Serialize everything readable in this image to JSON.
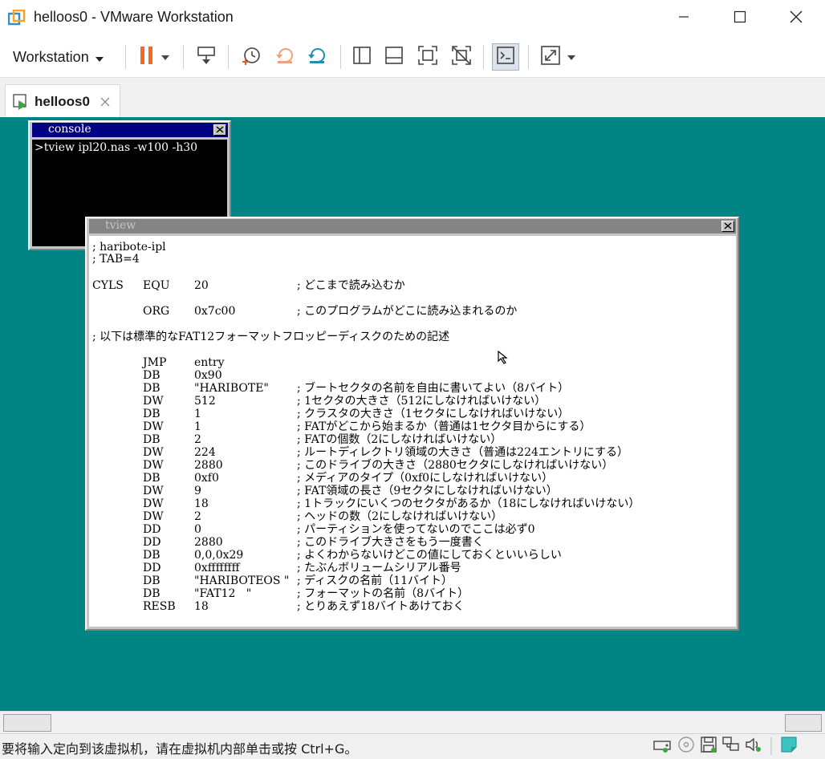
{
  "window": {
    "title": "helloos0 - VMware Workstation",
    "minimize_icon": "minimize-icon",
    "maximize_icon": "maximize-icon",
    "close_icon": "close-icon"
  },
  "toolbar": {
    "menu_label": "Workstation",
    "icons": [
      "pause-icon",
      "send-ctrl-alt-del-icon",
      "snapshot-take-icon",
      "snapshot-revert-icon",
      "snapshot-manager-icon",
      "view-sidebar-icon",
      "view-thumbnail-icon",
      "fullscreen-icon",
      "unity-disabled-icon",
      "console-view-icon",
      "stretch-icon"
    ]
  },
  "tabs": [
    {
      "label": "helloos0",
      "icon": "vm-running-icon",
      "close_icon": "tab-close-icon"
    }
  ],
  "guest": {
    "console": {
      "title": "console",
      "lines": [
        ">tview ipl20.nas -w100 -h30"
      ]
    },
    "tview": {
      "title": "tview",
      "header_lines": [
        "; haribote-ipl",
        "; TAB=4"
      ],
      "cyls": {
        "label": "CYLS",
        "op": "EQU",
        "arg": "20",
        "comment": "; どこまで読み込むか"
      },
      "org": {
        "op": "ORG",
        "arg": "0x7c00",
        "comment": "; このプログラムがどこに読み込まれるのか"
      },
      "section_comment": "; 以下は標準的なFAT12フォーマットフロッピーディスクのための記述",
      "rows": [
        {
          "op": "JMP",
          "arg": "entry",
          "comment": ""
        },
        {
          "op": "DB",
          "arg": "0x90",
          "comment": ""
        },
        {
          "op": "DB",
          "arg": "\"HARIBOTE\"",
          "comment": "; ブートセクタの名前を自由に書いてよい（8バイト）"
        },
        {
          "op": "DW",
          "arg": "512",
          "comment": "; 1セクタの大きさ（512にしなければいけない）"
        },
        {
          "op": "DB",
          "arg": "1",
          "comment": "; クラスタの大きさ（1セクタにしなければいけない）"
        },
        {
          "op": "DW",
          "arg": "1",
          "comment": "; FATがどこから始まるか（普通は1セクタ目からにする）"
        },
        {
          "op": "DB",
          "arg": "2",
          "comment": "; FATの個数（2にしなければいけない）"
        },
        {
          "op": "DW",
          "arg": "224",
          "comment": "; ルートディレクトリ領域の大きさ（普通は224エントリにする）"
        },
        {
          "op": "DW",
          "arg": "2880",
          "comment": "; このドライブの大きさ（2880セクタにしなければいけない）"
        },
        {
          "op": "DB",
          "arg": "0xf0",
          "comment": "; メディアのタイプ（0xf0にしなければいけない）"
        },
        {
          "op": "DW",
          "arg": "9",
          "comment": "; FAT領域の長さ（9セクタにしなければいけない）"
        },
        {
          "op": "DW",
          "arg": "18",
          "comment": "; 1トラックにいくつのセクタがあるか（18にしなければいけない）"
        },
        {
          "op": "DW",
          "arg": "2",
          "comment": "; ヘッドの数（2にしなければいけない）"
        },
        {
          "op": "DD",
          "arg": "0",
          "comment": "; パーティションを使ってないのでここは必ず0"
        },
        {
          "op": "DD",
          "arg": "2880",
          "comment": "; このドライブ大きさをもう一度書く"
        },
        {
          "op": "DB",
          "arg": "0,0,0x29",
          "comment": "; よくわからないけどこの値にしておくといいらしい"
        },
        {
          "op": "DD",
          "arg": "0xffffffff",
          "comment": "; たぶんボリュームシリアル番号"
        },
        {
          "op": "DB",
          "arg": "\"HARIBOTEOS \"",
          "comment": "; ディスクの名前（11バイト）"
        },
        {
          "op": "DB",
          "arg": "\"FAT12   \"",
          "comment": "; フォーマットの名前（8バイト）"
        },
        {
          "op": "RESB",
          "arg": "18",
          "comment": "; とりあえず18バイトあけておく"
        }
      ]
    }
  },
  "statusbar": {
    "message": "要将输入定向到该虚拟机，请在虚拟机内部单击或按 Ctrl+G。",
    "icons": [
      "hard-disk-icon",
      "cd-rom-icon",
      "floppy-icon",
      "network-icon",
      "sound-icon",
      "message-icon"
    ]
  },
  "colors": {
    "vm_background": "#008484",
    "console_title_active": "#000084",
    "tview_title_inactive": "#848484",
    "pause_orange": "#f26b21"
  }
}
